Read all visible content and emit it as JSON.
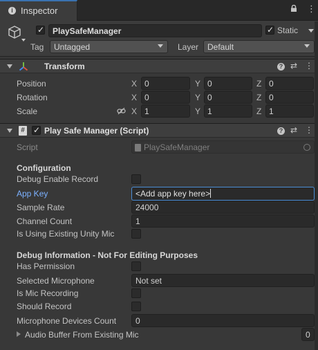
{
  "tab": {
    "title": "Inspector",
    "icon": "info-icon"
  },
  "gameobject": {
    "active": true,
    "name": "PlaySafeManager",
    "static_checked": true,
    "static_label": "Static",
    "tag_label": "Tag",
    "tag_value": "Untagged",
    "layer_label": "Layer",
    "layer_value": "Default"
  },
  "transform": {
    "title": "Transform",
    "rows": [
      {
        "label": "Position",
        "x": "0",
        "y": "0",
        "z": "0"
      },
      {
        "label": "Rotation",
        "x": "0",
        "y": "0",
        "z": "0"
      },
      {
        "label": "Scale",
        "x": "1",
        "y": "1",
        "z": "1"
      }
    ],
    "axis_labels": {
      "x": "X",
      "y": "Y",
      "z": "Z"
    }
  },
  "script_component": {
    "title": "Play Safe Manager (Script)",
    "enabled": true,
    "script_label": "Script",
    "script_value": "PlaySafeManager",
    "configuration_header": "Configuration",
    "debug_enable_record_label": "Debug Enable Record",
    "debug_enable_record_checked": false,
    "app_key_label": "App Key",
    "app_key_value": "<Add app key here>",
    "sample_rate_label": "Sample Rate",
    "sample_rate_value": "24000",
    "channel_count_label": "Channel Count",
    "channel_count_value": "1",
    "using_existing_mic_label": "Is Using Existing Unity Mic",
    "using_existing_mic_checked": false,
    "debug_header": "Debug Information - Not For Editing Purposes",
    "has_permission_label": "Has Permission",
    "has_permission_checked": false,
    "selected_microphone_label": "Selected Microphone",
    "selected_microphone_value": "Not set",
    "is_mic_recording_label": "Is Mic Recording",
    "is_mic_recording_checked": false,
    "should_record_label": "Should Record",
    "should_record_checked": false,
    "mic_devices_count_label": "Microphone Devices Count",
    "mic_devices_count_value": "0",
    "audio_buffer_label": "Audio Buffer From Existing Mic",
    "audio_buffer_value": "0"
  },
  "colors": {
    "background": "#383838",
    "accent": "#3a72b0",
    "field_focus": "#4b8dd6",
    "label_highlight": "#7cb1ff"
  }
}
